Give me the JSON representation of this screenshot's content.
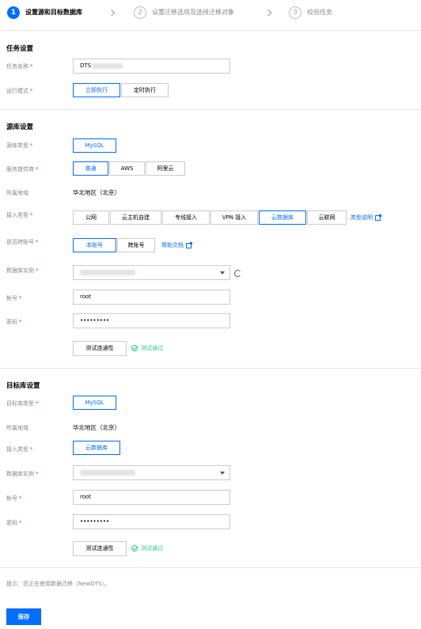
{
  "steps": [
    {
      "num": "1",
      "label": "设置源和目标数据库",
      "active": true
    },
    {
      "num": "2",
      "label": "设置迁移选项及选择迁移对象",
      "active": false
    },
    {
      "num": "3",
      "label": "校验任务",
      "active": false
    }
  ],
  "task": {
    "title": "任务设置",
    "name_label": "任务名称",
    "name_value": "DTS",
    "mode_label": "运行模式",
    "mode_options": [
      "立即执行",
      "定时执行"
    ]
  },
  "source": {
    "title": "源库设置",
    "type_label": "源库类型",
    "type_value": "MySQL",
    "provider_label": "服务提供商",
    "provider_options": [
      "普通",
      "AWS",
      "阿里云"
    ],
    "region_label": "所属地域",
    "region_value": "华北地区（北京）",
    "access_label": "接入类型",
    "access_options": [
      "公网",
      "云主机自建",
      "专线接入",
      "VPN 接入",
      "云数据库",
      "云联网"
    ],
    "access_help": "类型说明",
    "cross_label": "是否跨账号",
    "cross_options": [
      "本账号",
      "跨账号"
    ],
    "cross_help": "帮助文档",
    "instance_label": "数据库实例",
    "account_label": "帐号",
    "account_value": "root",
    "password_label": "密码",
    "password_value": "•••••••••",
    "test_button": "测试连通性",
    "test_result": "测试通过"
  },
  "target": {
    "title": "目标库设置",
    "type_label": "目标库类型",
    "type_value": "MySQL",
    "region_label": "所属地域",
    "region_value": "华北地区（北京）",
    "access_label": "接入类型",
    "access_value": "云数据库",
    "instance_label": "数据库实例",
    "account_label": "帐号",
    "account_value": "root",
    "password_label": "密码",
    "password_value": "•••••••••",
    "test_button": "测试连通性",
    "test_result": "测试通过"
  },
  "hint": "提示：您正在使用数据迁移（NewDTS）。",
  "save_label": "保存",
  "colors": {
    "primary": "#006eff",
    "success": "#29cc85",
    "required": "#e54545"
  }
}
